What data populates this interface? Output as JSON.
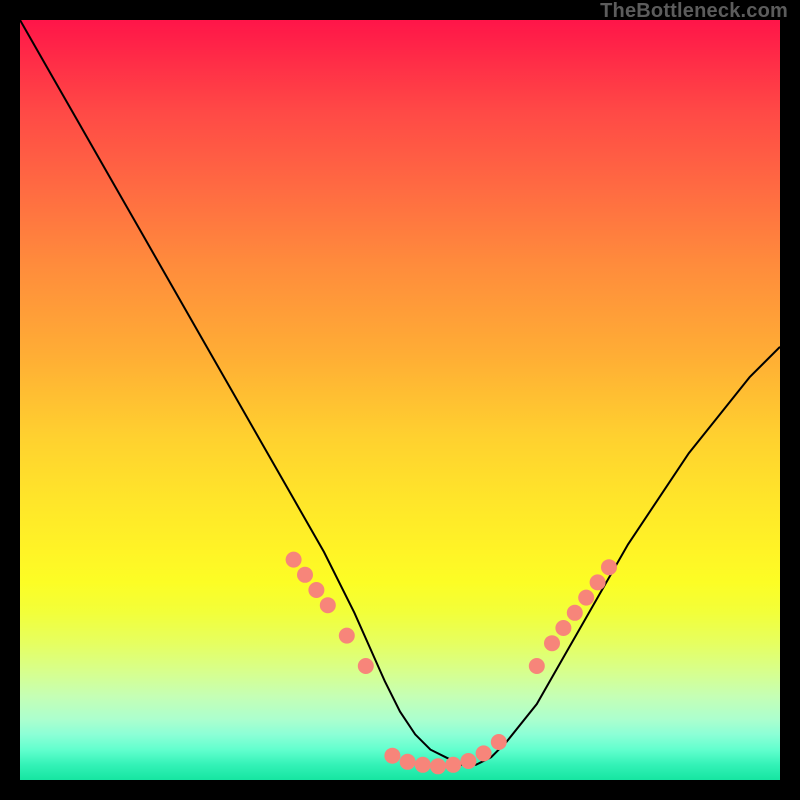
{
  "watermark": "TheBottleneck.com",
  "chart_data": {
    "type": "line",
    "title": "",
    "xlabel": "",
    "ylabel": "",
    "xlim": [
      0,
      100
    ],
    "ylim": [
      0,
      100
    ],
    "grid": false,
    "legend": false,
    "series": [
      {
        "name": "curve",
        "color": "#000000",
        "x": [
          0,
          4,
          8,
          12,
          16,
          20,
          24,
          28,
          32,
          36,
          40,
          44,
          48,
          50,
          52,
          54,
          56,
          58,
          60,
          62,
          64,
          68,
          72,
          76,
          80,
          84,
          88,
          92,
          96,
          100
        ],
        "y": [
          100,
          93,
          86,
          79,
          72,
          65,
          58,
          51,
          44,
          37,
          30,
          22,
          13,
          9,
          6,
          4,
          3,
          2,
          2,
          3,
          5,
          10,
          17,
          24,
          31,
          37,
          43,
          48,
          53,
          57
        ]
      },
      {
        "name": "markers-left",
        "type": "scatter",
        "color": "#f7857a",
        "x": [
          36,
          37.5,
          39,
          40.5,
          43,
          45.5
        ],
        "y": [
          29,
          27,
          25,
          23,
          19,
          15
        ]
      },
      {
        "name": "markers-bottom",
        "type": "scatter",
        "color": "#f7857a",
        "x": [
          49,
          51,
          53,
          55,
          57,
          59,
          61,
          63
        ],
        "y": [
          3.2,
          2.4,
          2.0,
          1.8,
          2.0,
          2.5,
          3.5,
          5.0
        ]
      },
      {
        "name": "markers-right",
        "type": "scatter",
        "color": "#f7857a",
        "x": [
          68,
          70,
          71.5,
          73,
          74.5,
          76,
          77.5
        ],
        "y": [
          15,
          18,
          20,
          22,
          24,
          26,
          28
        ]
      }
    ]
  }
}
